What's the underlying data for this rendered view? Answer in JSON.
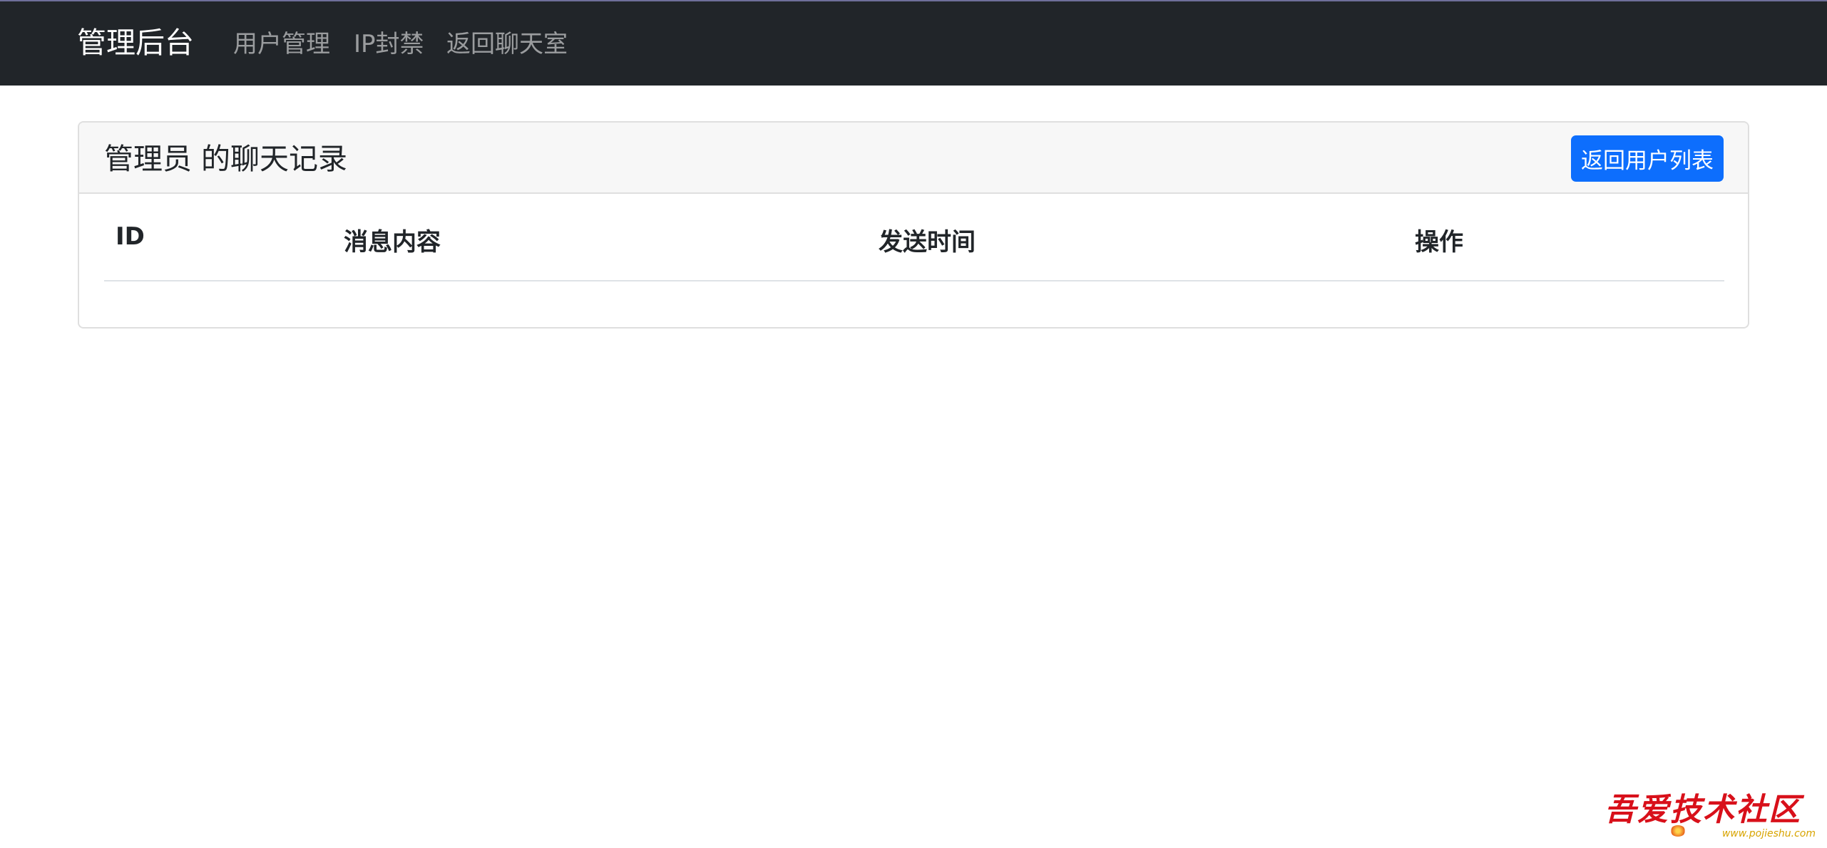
{
  "navbar": {
    "brand": "管理后台",
    "links": [
      "用户管理",
      "IP封禁",
      "返回聊天室"
    ]
  },
  "card": {
    "title": "管理员 的聊天记录",
    "back_button": "返回用户列表"
  },
  "table": {
    "headers": [
      "ID",
      "消息内容",
      "发送时间",
      "操作"
    ],
    "rows": []
  },
  "watermark": {
    "text": "吾爱技术社区",
    "url": "www.pojieshu.com"
  },
  "colors": {
    "navbar_bg": "#212529",
    "primary": "#0d6efd",
    "card_header_bg": "#f7f7f7"
  }
}
